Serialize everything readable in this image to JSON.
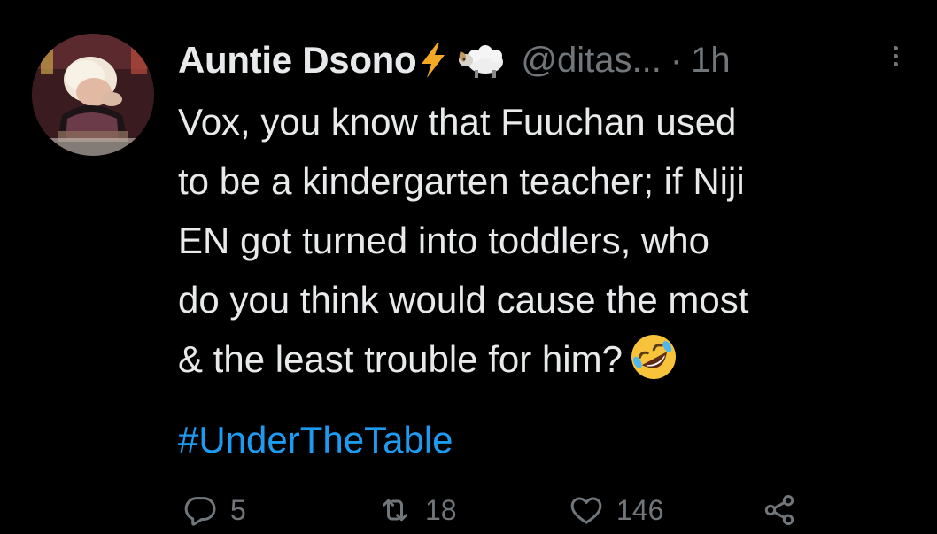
{
  "tweet": {
    "author": {
      "display_name": "Auntie Dsono",
      "name_emojis": [
        "lightning-bolt-emoji",
        "ram-emoji"
      ],
      "handle": "@ditas...",
      "separator": "·",
      "time": "1h"
    },
    "text_lines": [
      "Vox, you know that Fuuchan used",
      "to be a kindergarten teacher; if Niji",
      "EN got turned into toddlers, who",
      "do you think would cause the most",
      "& the least trouble for him?"
    ],
    "trailing_emoji": "rolling-on-the-floor-laughing-emoji",
    "hashtag": "#UnderTheTable",
    "actions": {
      "replies": "5",
      "retweets": "18",
      "likes": "146"
    }
  },
  "colors": {
    "background": "#000000",
    "text": "#e7e9ea",
    "muted": "#71767b",
    "link": "#1d9bf0"
  },
  "icons": {
    "reply": "reply-bubble-icon",
    "retweet": "retweet-icon",
    "like": "heart-icon",
    "share": "share-icon",
    "more": "more-options-icon"
  }
}
